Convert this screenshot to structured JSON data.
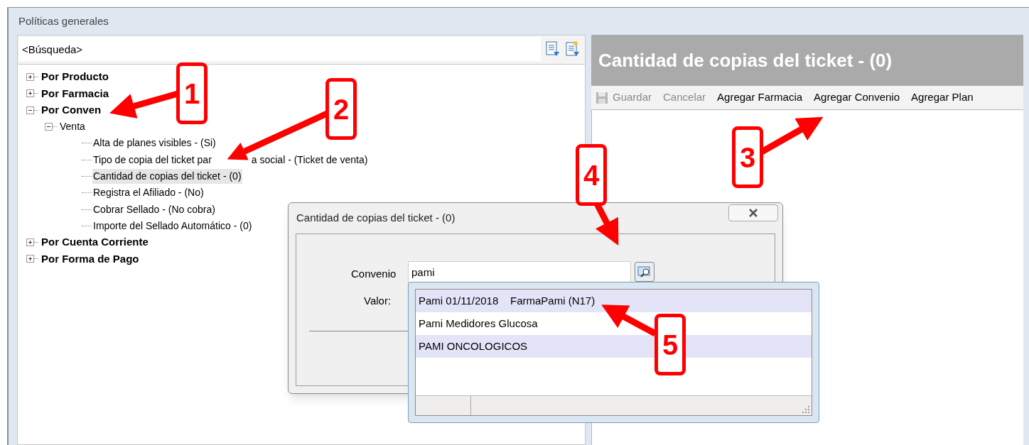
{
  "window": {
    "title": "Políticas generales"
  },
  "search": {
    "placeholder": "<Búsqueda>"
  },
  "tree": [
    {
      "label": "Por Producto",
      "expanded": false,
      "selected": false
    },
    {
      "label": "Por Farmacia",
      "expanded": false,
      "selected": false
    },
    {
      "label": "Por Conven",
      "expanded": true,
      "selected": false,
      "children": [
        {
          "label": "Venta",
          "expanded": true,
          "selected": false,
          "children": [
            {
              "label": "Alta de planes visibles - (Si)",
              "selected": false
            },
            {
              "label_parts": [
                "Tipo de copia del ticket par",
                "a social - (Ticket de venta)"
              ],
              "selected": false
            },
            {
              "label": "Cantidad de copias del ticket - (0)",
              "selected": true
            },
            {
              "label": "Registra el Afiliado - (No)",
              "selected": false
            },
            {
              "label": "Cobrar Sellado - (No cobra)",
              "selected": false
            },
            {
              "label": "Importe del Sellado Automático - (0)",
              "selected": false
            }
          ]
        }
      ]
    },
    {
      "label": "Por Cuenta Corriente",
      "expanded": false,
      "selected": false
    },
    {
      "label": "Por Forma de Pago",
      "expanded": false,
      "selected": false
    }
  ],
  "detail": {
    "title": "Cantidad de copias del ticket - (0)",
    "toolbar": [
      {
        "label": "Guardar",
        "kind": "with-icon",
        "disabled": true
      },
      {
        "label": "Cancelar",
        "kind": "plain",
        "disabled": true
      },
      {
        "label": "Agregar Farmacia",
        "kind": "plain",
        "disabled": false
      },
      {
        "label": "Agregar Convenio",
        "kind": "plain",
        "disabled": false
      },
      {
        "label": "Agregar Plan",
        "kind": "plain",
        "disabled": false
      }
    ]
  },
  "dialog": {
    "title": "Cantidad de copias del ticket - (0)",
    "convenio_label": "Convenio",
    "convenio_value": "pami",
    "valor_label": "Valor:"
  },
  "dropdown": {
    "rows": [
      {
        "label": "Pami 01/11/2018    FarmaPami (N17)",
        "selected": true
      },
      {
        "label": "Pami Medidores Glucosa",
        "selected": false
      },
      {
        "label": "PAMI ONCOLOGICOS",
        "selected": true
      }
    ]
  },
  "callouts": [
    {
      "label": "1"
    },
    {
      "label": "2"
    },
    {
      "label": "3"
    },
    {
      "label": "4"
    },
    {
      "label": "5"
    }
  ]
}
